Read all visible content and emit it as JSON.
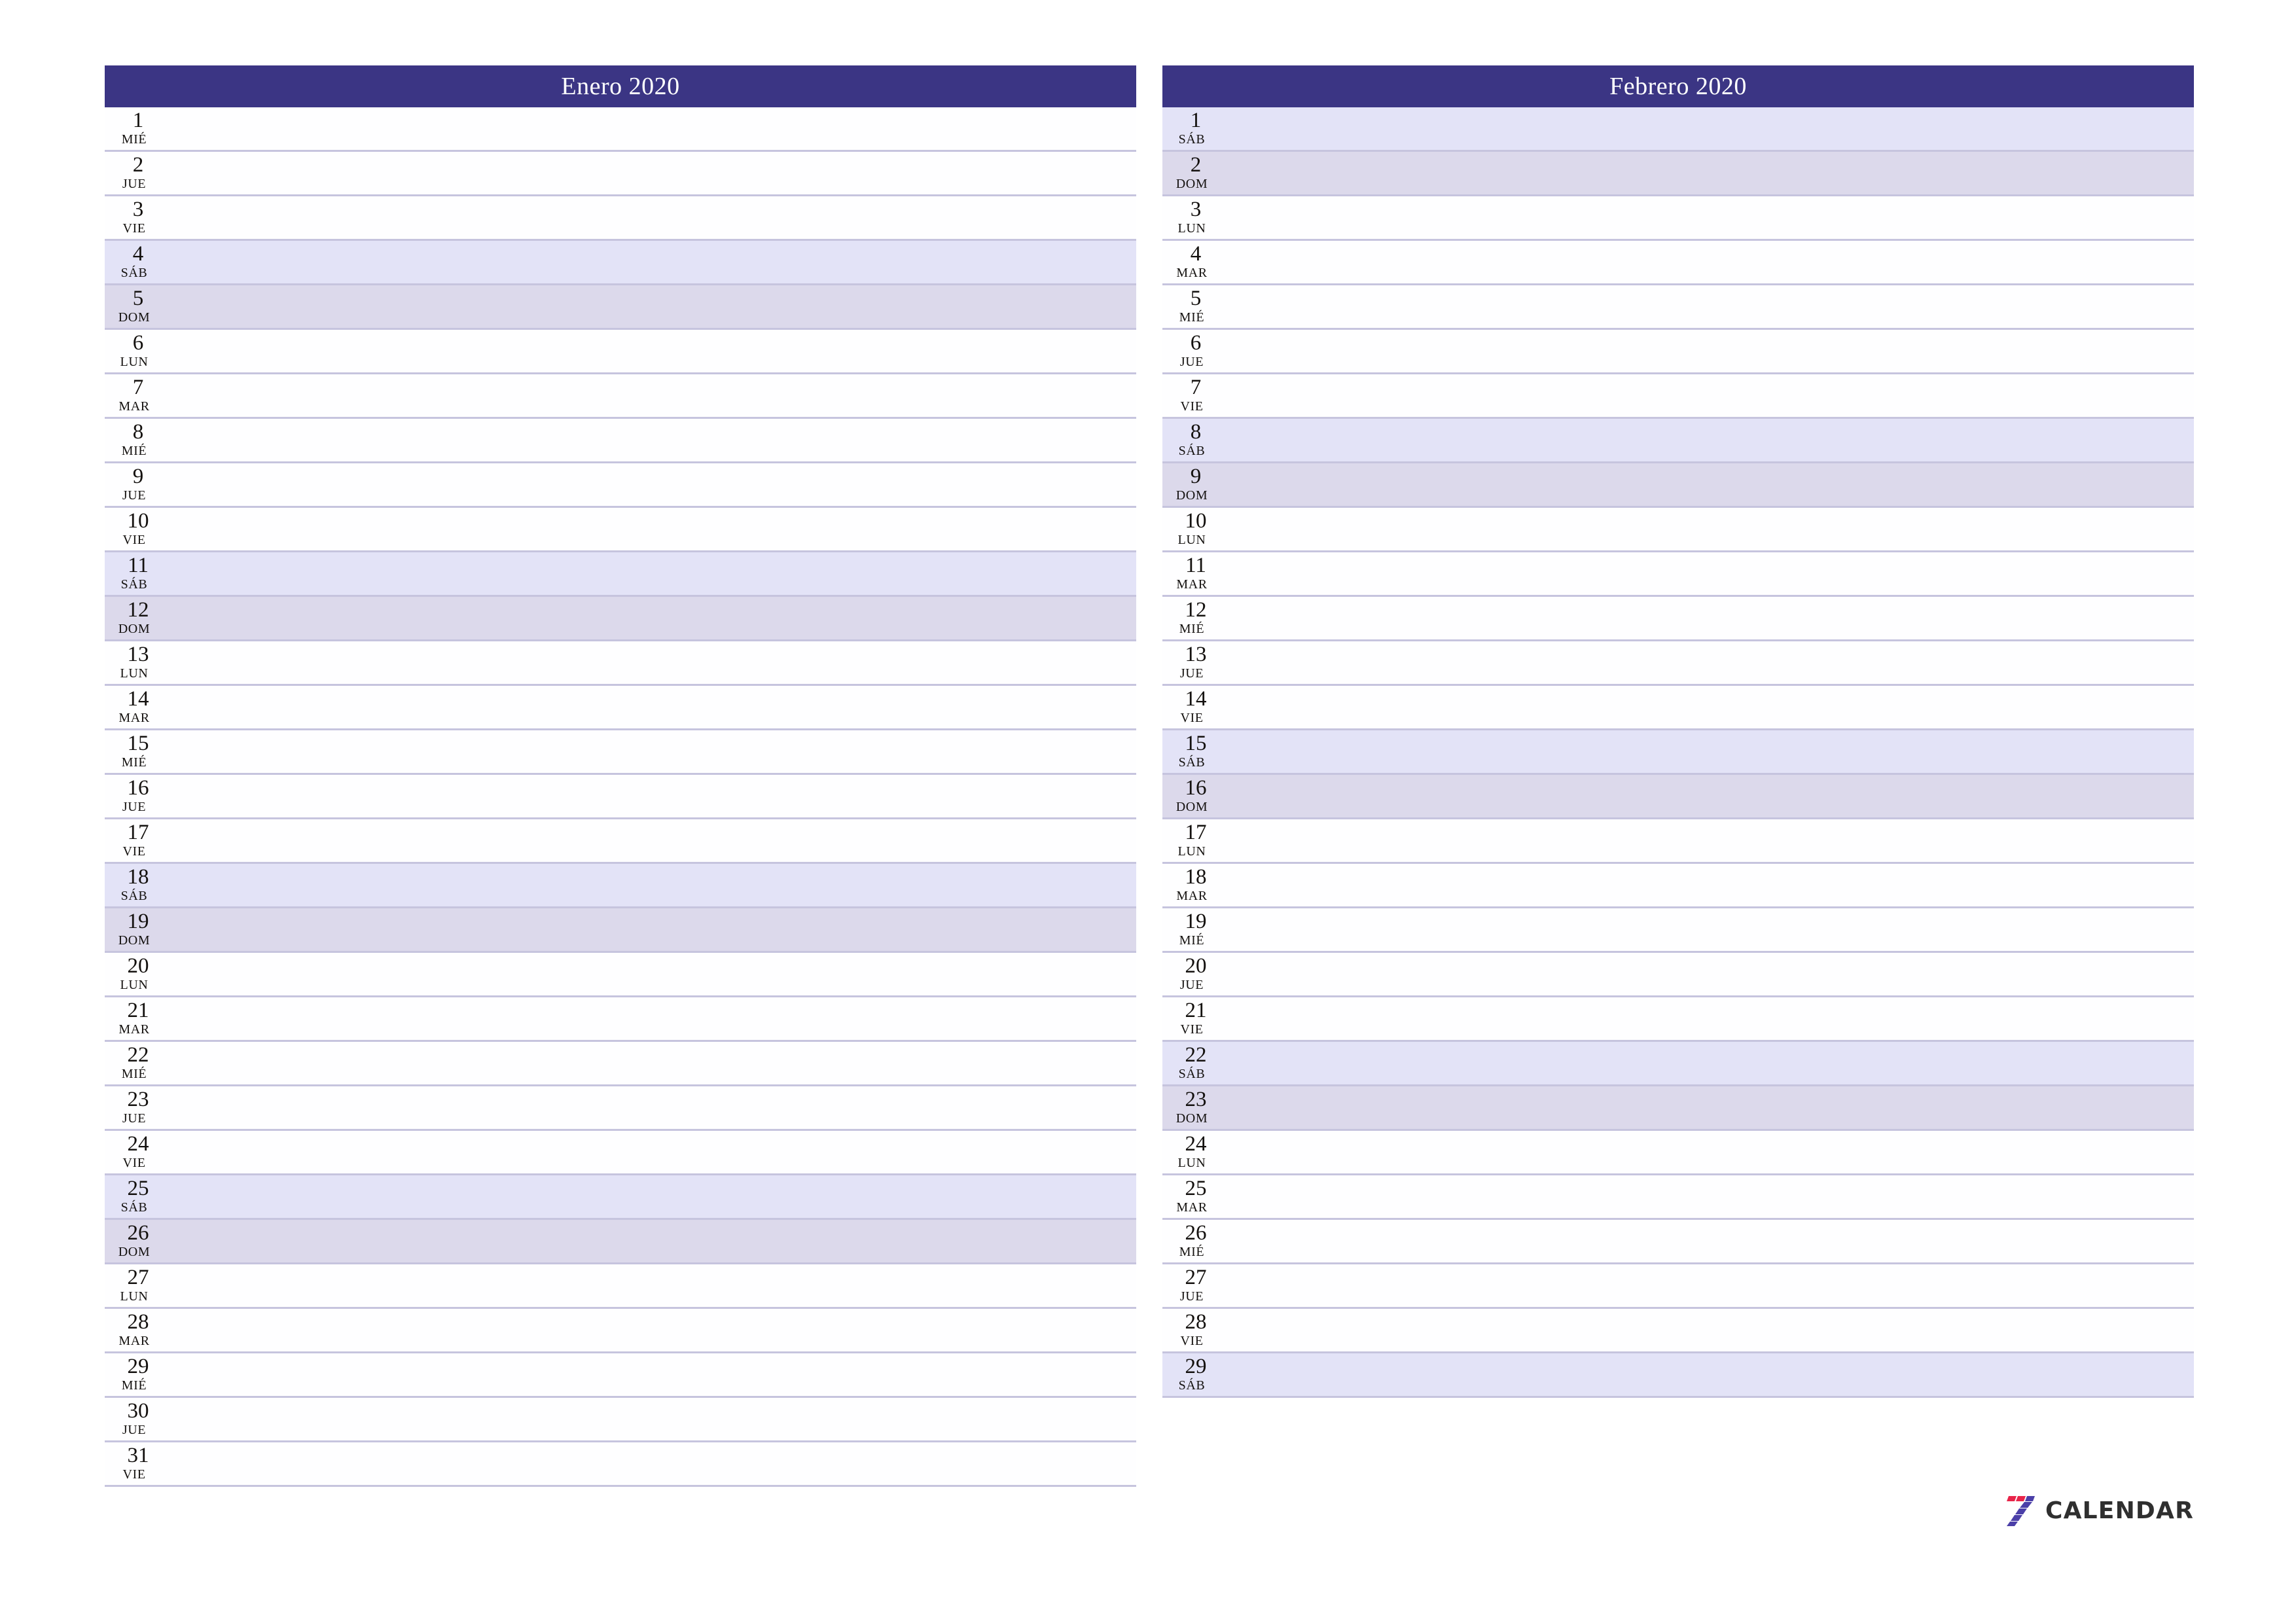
{
  "page": {
    "type": "monthly-planner",
    "locale": "es",
    "background_color": "#ffffff"
  },
  "colors": {
    "header_background": "#3b3584",
    "header_text": "#ffffff",
    "saturday_row": "#e3e3f7",
    "sunday_row": "#dcd9eb",
    "weekday_row": "#fefeff",
    "row_divider": "#c6c4de",
    "logo_red": "#e8254a",
    "logo_purple": "#4b3fa8",
    "logo_text": "#2f2f2f"
  },
  "months": [
    {
      "title": "Enero 2020",
      "days": [
        {
          "num": "1",
          "weekday": "MIÉ",
          "kind": "weekday"
        },
        {
          "num": "2",
          "weekday": "JUE",
          "kind": "weekday"
        },
        {
          "num": "3",
          "weekday": "VIE",
          "kind": "weekday"
        },
        {
          "num": "4",
          "weekday": "SÁB",
          "kind": "sat"
        },
        {
          "num": "5",
          "weekday": "DOM",
          "kind": "sun"
        },
        {
          "num": "6",
          "weekday": "LUN",
          "kind": "weekday"
        },
        {
          "num": "7",
          "weekday": "MAR",
          "kind": "weekday"
        },
        {
          "num": "8",
          "weekday": "MIÉ",
          "kind": "weekday"
        },
        {
          "num": "9",
          "weekday": "JUE",
          "kind": "weekday"
        },
        {
          "num": "10",
          "weekday": "VIE",
          "kind": "weekday"
        },
        {
          "num": "11",
          "weekday": "SÁB",
          "kind": "sat"
        },
        {
          "num": "12",
          "weekday": "DOM",
          "kind": "sun"
        },
        {
          "num": "13",
          "weekday": "LUN",
          "kind": "weekday"
        },
        {
          "num": "14",
          "weekday": "MAR",
          "kind": "weekday"
        },
        {
          "num": "15",
          "weekday": "MIÉ",
          "kind": "weekday"
        },
        {
          "num": "16",
          "weekday": "JUE",
          "kind": "weekday"
        },
        {
          "num": "17",
          "weekday": "VIE",
          "kind": "weekday"
        },
        {
          "num": "18",
          "weekday": "SÁB",
          "kind": "sat"
        },
        {
          "num": "19",
          "weekday": "DOM",
          "kind": "sun"
        },
        {
          "num": "20",
          "weekday": "LUN",
          "kind": "weekday"
        },
        {
          "num": "21",
          "weekday": "MAR",
          "kind": "weekday"
        },
        {
          "num": "22",
          "weekday": "MIÉ",
          "kind": "weekday"
        },
        {
          "num": "23",
          "weekday": "JUE",
          "kind": "weekday"
        },
        {
          "num": "24",
          "weekday": "VIE",
          "kind": "weekday"
        },
        {
          "num": "25",
          "weekday": "SÁB",
          "kind": "sat"
        },
        {
          "num": "26",
          "weekday": "DOM",
          "kind": "sun"
        },
        {
          "num": "27",
          "weekday": "LUN",
          "kind": "weekday"
        },
        {
          "num": "28",
          "weekday": "MAR",
          "kind": "weekday"
        },
        {
          "num": "29",
          "weekday": "MIÉ",
          "kind": "weekday"
        },
        {
          "num": "30",
          "weekday": "JUE",
          "kind": "weekday"
        },
        {
          "num": "31",
          "weekday": "VIE",
          "kind": "weekday"
        }
      ]
    },
    {
      "title": "Febrero 2020",
      "days": [
        {
          "num": "1",
          "weekday": "SÁB",
          "kind": "sat"
        },
        {
          "num": "2",
          "weekday": "DOM",
          "kind": "sun"
        },
        {
          "num": "3",
          "weekday": "LUN",
          "kind": "weekday"
        },
        {
          "num": "4",
          "weekday": "MAR",
          "kind": "weekday"
        },
        {
          "num": "5",
          "weekday": "MIÉ",
          "kind": "weekday"
        },
        {
          "num": "6",
          "weekday": "JUE",
          "kind": "weekday"
        },
        {
          "num": "7",
          "weekday": "VIE",
          "kind": "weekday"
        },
        {
          "num": "8",
          "weekday": "SÁB",
          "kind": "sat"
        },
        {
          "num": "9",
          "weekday": "DOM",
          "kind": "sun"
        },
        {
          "num": "10",
          "weekday": "LUN",
          "kind": "weekday"
        },
        {
          "num": "11",
          "weekday": "MAR",
          "kind": "weekday"
        },
        {
          "num": "12",
          "weekday": "MIÉ",
          "kind": "weekday"
        },
        {
          "num": "13",
          "weekday": "JUE",
          "kind": "weekday"
        },
        {
          "num": "14",
          "weekday": "VIE",
          "kind": "weekday"
        },
        {
          "num": "15",
          "weekday": "SÁB",
          "kind": "sat"
        },
        {
          "num": "16",
          "weekday": "DOM",
          "kind": "sun"
        },
        {
          "num": "17",
          "weekday": "LUN",
          "kind": "weekday"
        },
        {
          "num": "18",
          "weekday": "MAR",
          "kind": "weekday"
        },
        {
          "num": "19",
          "weekday": "MIÉ",
          "kind": "weekday"
        },
        {
          "num": "20",
          "weekday": "JUE",
          "kind": "weekday"
        },
        {
          "num": "21",
          "weekday": "VIE",
          "kind": "weekday"
        },
        {
          "num": "22",
          "weekday": "SÁB",
          "kind": "sat"
        },
        {
          "num": "23",
          "weekday": "DOM",
          "kind": "sun"
        },
        {
          "num": "24",
          "weekday": "LUN",
          "kind": "weekday"
        },
        {
          "num": "25",
          "weekday": "MAR",
          "kind": "weekday"
        },
        {
          "num": "26",
          "weekday": "MIÉ",
          "kind": "weekday"
        },
        {
          "num": "27",
          "weekday": "JUE",
          "kind": "weekday"
        },
        {
          "num": "28",
          "weekday": "VIE",
          "kind": "weekday"
        },
        {
          "num": "29",
          "weekday": "SÁB",
          "kind": "sat"
        }
      ]
    }
  ],
  "logo": {
    "mark": "seven-logo-icon",
    "text": "CALENDAR"
  }
}
